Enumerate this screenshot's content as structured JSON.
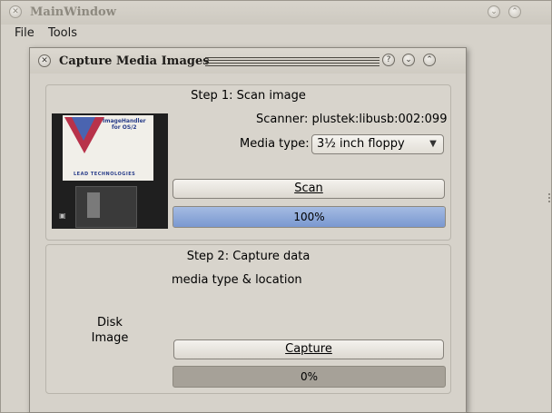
{
  "main_window": {
    "title": "MainWindow",
    "menu": [
      "File",
      "Tools"
    ]
  },
  "dialog": {
    "title": "Capture Media Images",
    "step1": {
      "title": "Step 1: Scan image",
      "scanner_label": "Scanner: plustek:libusb:002:099",
      "media_type_label": "Media type:",
      "media_type_value": "3½ inch floppy",
      "scan_button": "Scan",
      "progress_text": "100%",
      "progress_value": 100
    },
    "step2": {
      "title": "Step 2: Capture data",
      "info_label": "media type & location",
      "disk_image_label_line1": "Disk",
      "disk_image_label_line2": "Image",
      "capture_button": "Capture",
      "progress_text": "0%",
      "progress_value": 0
    }
  },
  "floppy_label": {
    "title_line1": "ImageHandler",
    "title_line2": "for OS/2",
    "brand": "LEAD TECHNOLOGIES"
  },
  "colors": {
    "progress_fill": "#7a98d0",
    "background": "#d6d2ca"
  },
  "icons": {
    "close": "close-icon",
    "help": "help-icon",
    "minimize": "minimize-icon",
    "maximize": "maximize-icon"
  }
}
